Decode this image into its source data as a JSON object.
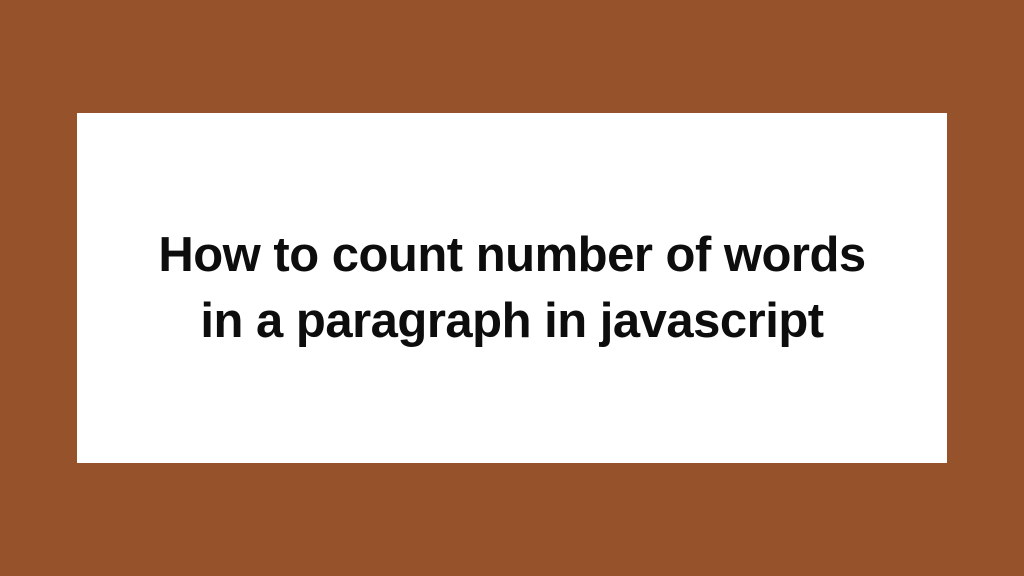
{
  "card": {
    "title": "How to count number of words in a paragraph in javascript"
  },
  "colors": {
    "background": "#96532b",
    "card_background": "#ffffff",
    "text": "#0d0d0d"
  }
}
